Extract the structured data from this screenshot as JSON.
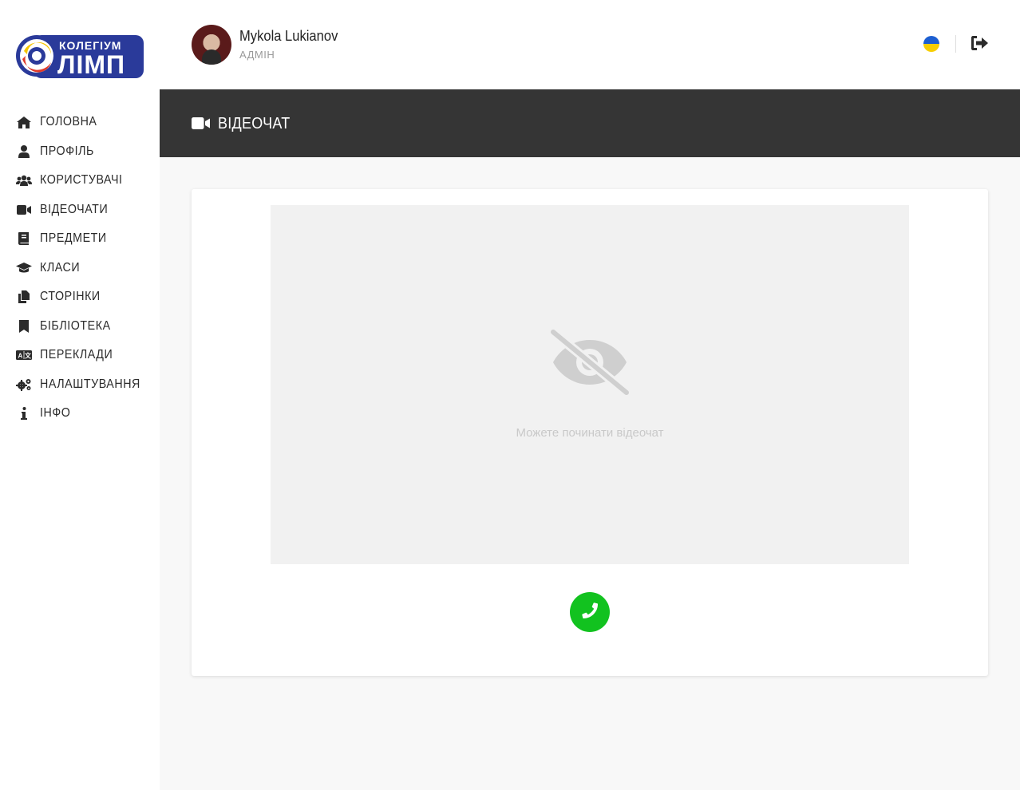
{
  "logo": {
    "top_text": "КОЛЕГІУМ",
    "main_text": "ЛІМП",
    "colors": {
      "brand_blue": "#2a3a9a",
      "ring_red": "#e03a2a",
      "ring_yellow": "#f5c400"
    }
  },
  "sidebar": {
    "items": [
      {
        "label": "ГОЛОВНА",
        "icon": "home-icon"
      },
      {
        "label": "ПРОФІЛЬ",
        "icon": "user-icon"
      },
      {
        "label": "КОРИСТУВАЧІ",
        "icon": "users-icon"
      },
      {
        "label": "ВІДЕОЧАТИ",
        "icon": "video-camera-icon"
      },
      {
        "label": "ПРЕДМЕТИ",
        "icon": "book-icon"
      },
      {
        "label": "КЛАСИ",
        "icon": "graduation-cap-icon"
      },
      {
        "label": "СТОРІНКИ",
        "icon": "copy-pages-icon"
      },
      {
        "label": "БІБЛІОТЕКА",
        "icon": "bookmark-icon"
      },
      {
        "label": "ПЕРЕКЛАДИ",
        "icon": "language-icon"
      },
      {
        "label": "НАЛАШТУВАННЯ",
        "icon": "cogs-icon"
      },
      {
        "label": "ІНФО",
        "icon": "info-icon"
      }
    ]
  },
  "user": {
    "name": "Mykola Lukianov",
    "role": "АДМІН"
  },
  "topbar": {
    "language_flag": "ukraine-flag-icon",
    "logout_icon": "sign-out-icon"
  },
  "header": {
    "title": "ВІДЕОЧАТ",
    "icon": "video-camera-icon",
    "background": "#353535"
  },
  "videochat": {
    "placeholder_message": "Можете починати відеочат",
    "placeholder_icon": "eye-slash-icon",
    "call_button_icon": "phone-icon",
    "call_button_color": "#12c21f"
  }
}
